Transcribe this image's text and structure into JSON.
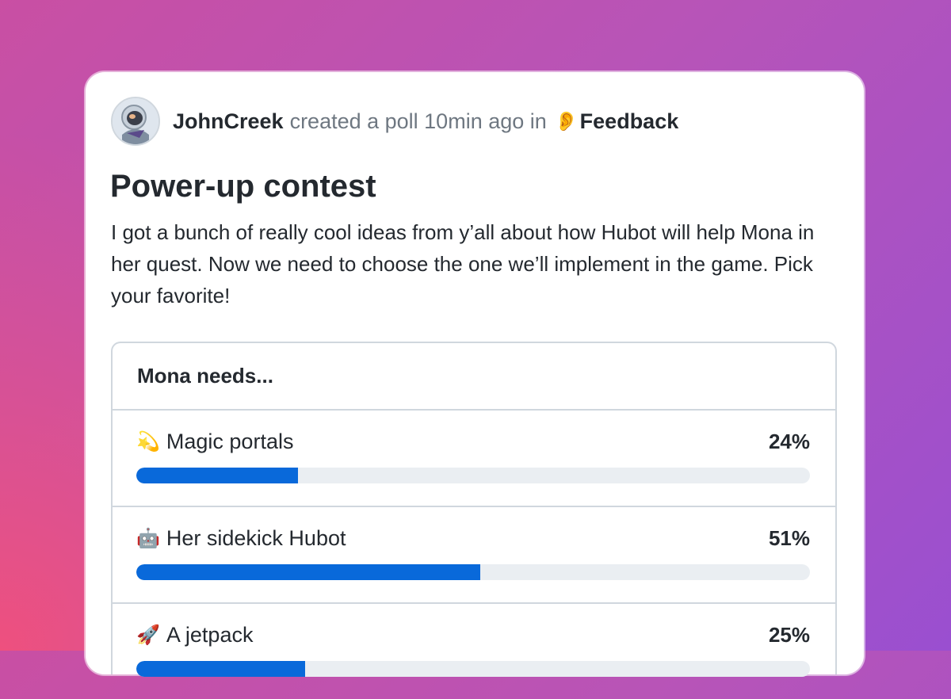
{
  "post": {
    "author": "JohnCreek",
    "action": "created a poll 10min ago in",
    "category_emoji": "👂",
    "category": "Feedback",
    "title": "Power-up contest",
    "description": "I got a bunch of really cool ideas from y’all about how Hubot will help Mona in her quest. Now we need to choose the one we’ll implement in the game. Pick your favorite!"
  },
  "poll": {
    "question": "Mona needs...",
    "options": [
      {
        "emoji": "💫",
        "label": "Magic portals",
        "percent_label": "24%",
        "percent": 24
      },
      {
        "emoji": "🤖",
        "label": "Her sidekick Hubot",
        "percent_label": "51%",
        "percent": 51
      },
      {
        "emoji": "🚀",
        "label": "A jetpack",
        "percent_label": "25%",
        "percent": 25
      }
    ]
  },
  "colors": {
    "bar_fill": "#0969da",
    "bar_track": "#eaeef2"
  }
}
